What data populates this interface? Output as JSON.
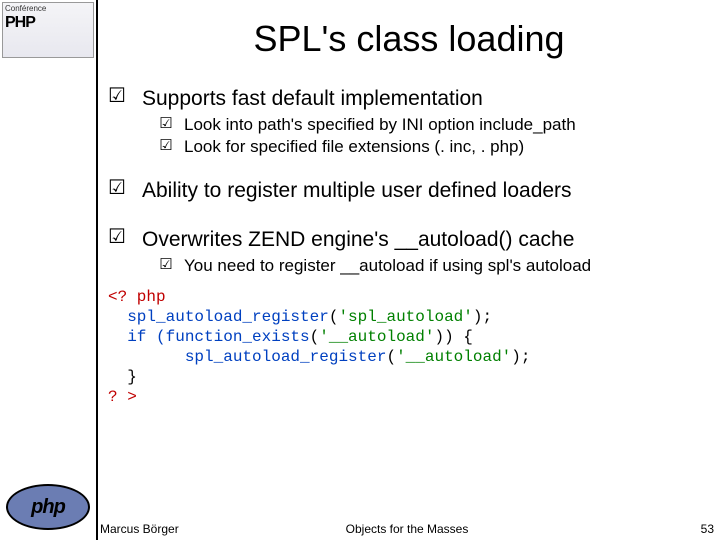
{
  "logo": {
    "top_line1": "Conférence",
    "top_line2": "PHP",
    "bottom": "php"
  },
  "title": "SPL's class loading",
  "bullets": [
    {
      "text": "Supports fast default implementation",
      "subs": [
        "Look into path's specified by INI option include_path",
        "Look for specified file extensions (. inc, . php)"
      ]
    },
    {
      "text": "Ability to register multiple user defined loaders",
      "subs": []
    },
    {
      "text": "Overwrites ZEND engine's __autoload() cache",
      "subs": [
        "You need to register __autoload if using spl's autoload"
      ]
    }
  ],
  "code": {
    "open": "<? php",
    "l1a": "spl_autoload_register",
    "l1b": "(",
    "l1c": "'spl_autoload'",
    "l1d": ");",
    "l2a": "if (",
    "l2b": "function_exists",
    "l2c": "(",
    "l2d": "'__autoload'",
    "l2e": ")) {",
    "l3a": "spl_autoload_register",
    "l3b": "(",
    "l3c": "'__autoload'",
    "l3d": ");",
    "l4": "}",
    "close": "? >"
  },
  "footer": {
    "author": "Marcus Börger",
    "deck": "Objects for the Masses",
    "page": "53"
  },
  "glyph": {
    "check": "☑"
  }
}
